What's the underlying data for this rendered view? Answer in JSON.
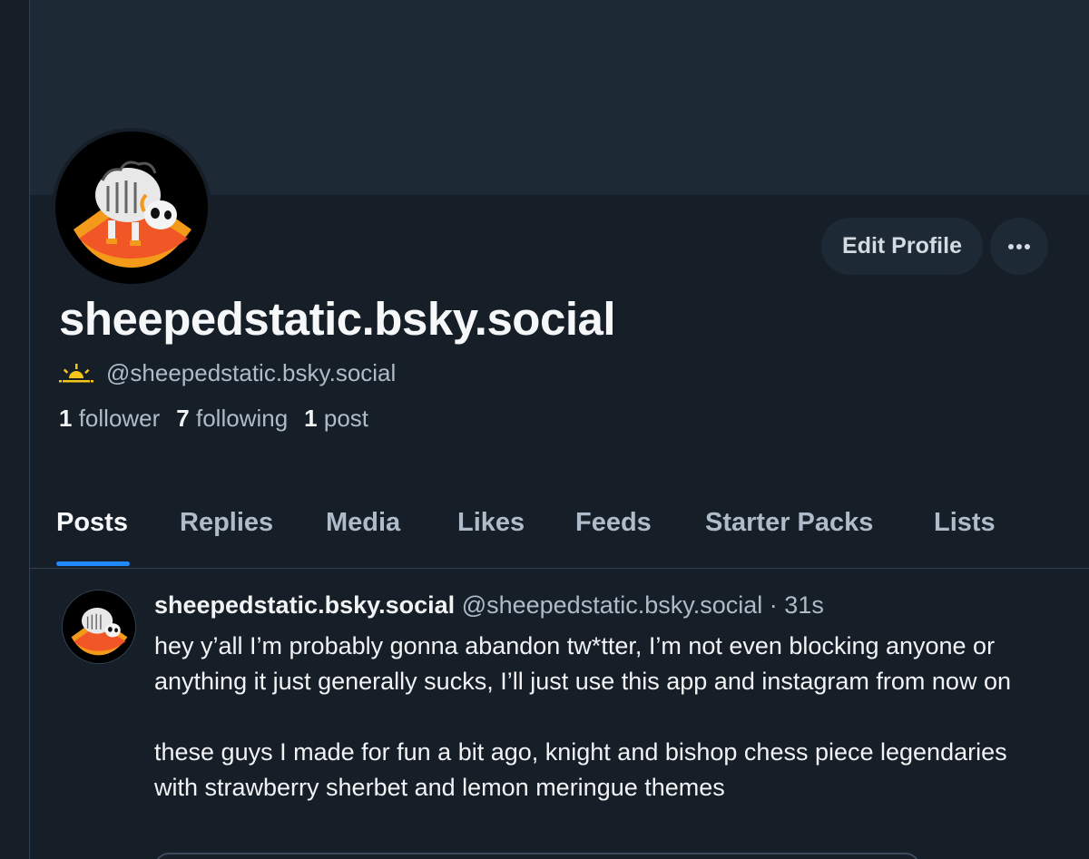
{
  "profile": {
    "display_name": "sheepedstatic.bsky.social",
    "handle": "@sheepedstatic.bsky.social",
    "edit_profile_label": "Edit Profile",
    "stats": {
      "followers_count": "1",
      "followers_label": "follower",
      "following_count": "7",
      "following_label": "following",
      "posts_count": "1",
      "posts_label": "post"
    }
  },
  "tabs": [
    {
      "label": "Posts",
      "active": true
    },
    {
      "label": "Replies",
      "active": false
    },
    {
      "label": "Media",
      "active": false
    },
    {
      "label": "Likes",
      "active": false
    },
    {
      "label": "Feeds",
      "active": false
    },
    {
      "label": "Starter Packs",
      "active": false
    },
    {
      "label": "Lists",
      "active": false
    }
  ],
  "post": {
    "author_name": "sheepedstatic.bsky.social",
    "author_handle": "@sheepedstatic.bsky.social",
    "separator": "·",
    "time": "31s",
    "paragraph_1": "hey y’all I’m probably gonna abandon tw*tter, I’m not even blocking anyone or anything it just generally sucks, I’ll just use this app and instagram from now on",
    "paragraph_2": "these guys I made for fun a bit ago, knight and bishop chess piece legendaries with strawberry sherbet and lemon meringue themes"
  },
  "icons": {
    "handle_badge": "sunrise-icon",
    "more": "more-horizontal-icon"
  },
  "colors": {
    "background": "#161e27",
    "banner": "#1e2936",
    "accent": "#208bfe",
    "muted_text": "#aebbc9",
    "badge_yellow": "#f5c518"
  }
}
